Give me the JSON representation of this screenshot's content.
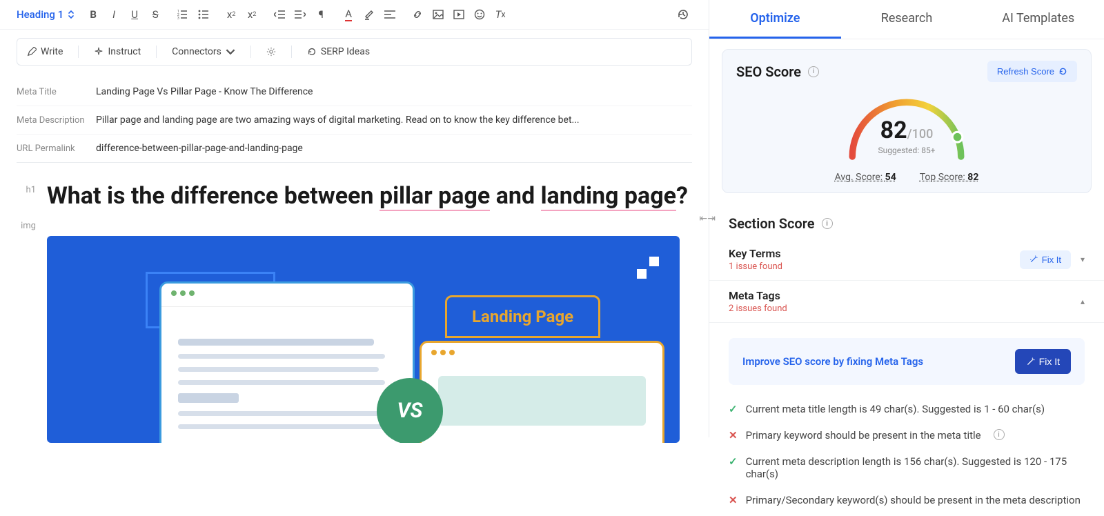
{
  "toolbar": {
    "heading_label": "Heading 1"
  },
  "ai_bar": {
    "write": "Write",
    "instruct": "Instruct",
    "connectors": "Connectors",
    "serp_ideas": "SERP Ideas"
  },
  "meta": {
    "title_label": "Meta Title",
    "title_value": "Landing Page Vs Pillar Page - Know The Difference",
    "desc_label": "Meta Description",
    "desc_value": "Pillar page and landing page are two amazing ways of digital marketing. Read on to know the key difference bet...",
    "url_label": "URL Permalink",
    "url_value": "difference-between-pillar-page-and-landing-page"
  },
  "editor": {
    "h1_tag": "h1",
    "h1_pre": "What is the difference between ",
    "h1_kw1": "pillar page",
    "h1_mid": " and ",
    "h1_kw2": "landing page",
    "h1_post": "?",
    "img_tag": "img",
    "landing_label": "Landing Page",
    "vs": "VS"
  },
  "tabs": {
    "optimize": "Optimize",
    "research": "Research",
    "ai_templates": "AI Templates"
  },
  "seo": {
    "title": "SEO Score",
    "refresh": "Refresh Score",
    "score": "82",
    "denominator": "/100",
    "suggested": "Suggested: 85+",
    "avg_label": "Avg. Score: ",
    "avg_value": "54",
    "top_label": "Top Score: ",
    "top_value": "82"
  },
  "section": {
    "title": "Section Score",
    "key_terms": {
      "name": "Key Terms",
      "issues": "1 issue found",
      "fix": "Fix It"
    },
    "meta_tags": {
      "name": "Meta Tags",
      "issues": "2 issues found"
    }
  },
  "banner": {
    "text": "Improve SEO score by fixing Meta Tags",
    "fix": "Fix It"
  },
  "checks": {
    "c1": "Current meta title length is 49 char(s). Suggested is 1 - 60 char(s)",
    "c2": "Primary keyword should be present in the meta title",
    "c3": "Current meta description length is 156 char(s). Suggested is 120 - 175 char(s)",
    "c4": "Primary/Secondary keyword(s) should be present in the meta description"
  }
}
